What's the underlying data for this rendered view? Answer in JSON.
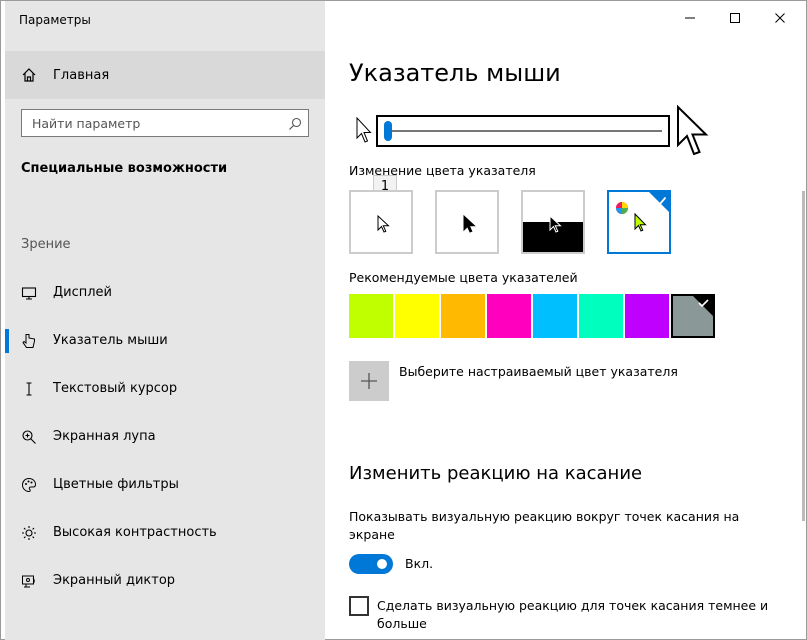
{
  "window": {
    "title": "Параметры"
  },
  "sidebar": {
    "home_label": "Главная",
    "search_placeholder": "Найти параметр",
    "section_title": "Специальные возможности",
    "group_title": "Зрение",
    "items": [
      {
        "label": "Дисплей",
        "icon": "monitor-icon",
        "active": false
      },
      {
        "label": "Указатель мыши",
        "icon": "mouse-pointer-icon",
        "active": true
      },
      {
        "label": "Текстовый курсор",
        "icon": "text-cursor-icon",
        "active": false
      },
      {
        "label": "Экранная лупа",
        "icon": "magnifier-icon",
        "active": false
      },
      {
        "label": "Цветные фильтры",
        "icon": "palette-icon",
        "active": false
      },
      {
        "label": "Высокая контрастность",
        "icon": "brightness-icon",
        "active": false
      },
      {
        "label": "Экранный диктор",
        "icon": "narrator-icon",
        "active": false
      }
    ]
  },
  "main": {
    "title": "Указатель мыши",
    "slider": {
      "value": 1,
      "tooltip": "1"
    },
    "color_section_label": "Изменение цвета указателя",
    "color_options": [
      {
        "name": "white",
        "selected": false
      },
      {
        "name": "black",
        "selected": false
      },
      {
        "name": "inverted",
        "selected": false
      },
      {
        "name": "custom",
        "selected": true
      }
    ],
    "recommended_label": "Рекомендуемые цвета указателей",
    "recommended_colors": [
      "#bfff00",
      "#ffff00",
      "#ffb900",
      "#ff00bf",
      "#00bfff",
      "#00ffbf",
      "#bf00ff",
      "#8a9898"
    ],
    "selected_color_index": 7,
    "add_color_label": "Выберите настраиваемый цвет указателя",
    "touch_title": "Изменить реакцию на касание",
    "touch_desc": "Показывать визуальную реакцию вокруг точек касания на экране",
    "toggle_label": "Вкл.",
    "toggle_on": true,
    "checkbox_label": "Сделать визуальную реакцию для точек касания темнее и больше",
    "checkbox_checked": false
  }
}
